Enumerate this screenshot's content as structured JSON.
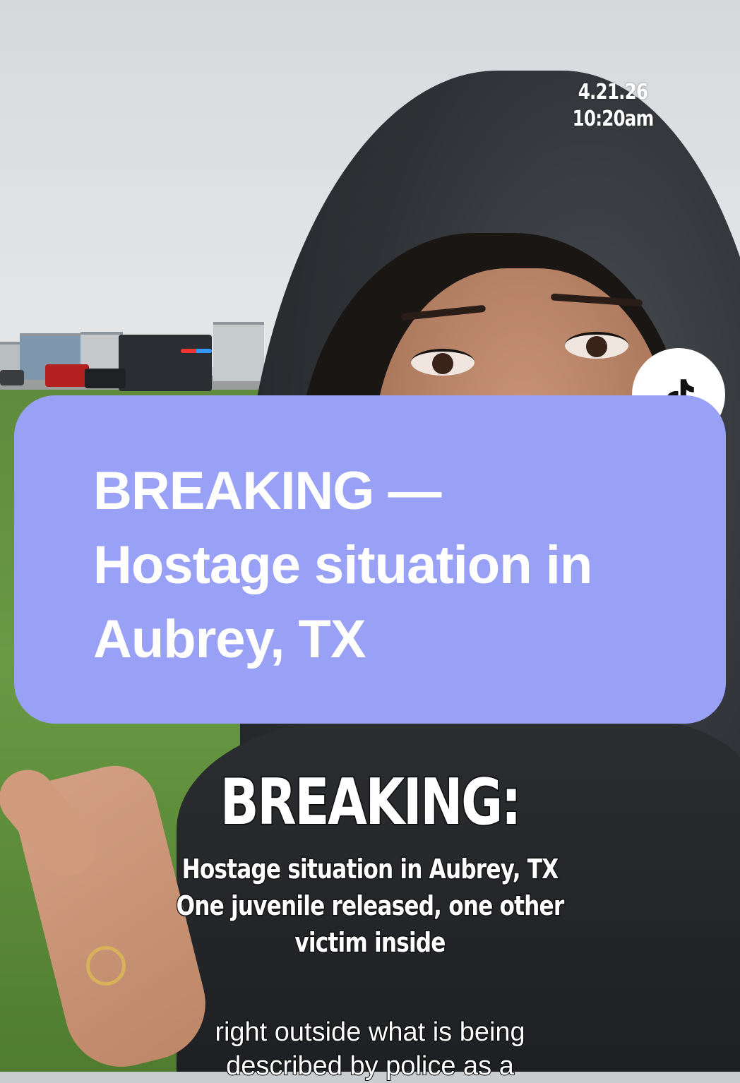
{
  "video": {
    "date_stamp": {
      "date": "4.21.26",
      "time": "10:20am"
    },
    "platform_icon": "tiktok-icon",
    "headline_card": {
      "line1": "BREAKING —",
      "line2": "Hostage situation in",
      "line3": "Aubrey, TX",
      "background_color": "#98a1f6"
    },
    "caption": {
      "title": "BREAKING:",
      "line1": "Hostage situation in Aubrey, TX",
      "line2": "One juvenile released, one other",
      "line3": "victim inside"
    },
    "subtitle": {
      "line1": "right outside what is being",
      "line2": "described by police as a"
    }
  }
}
